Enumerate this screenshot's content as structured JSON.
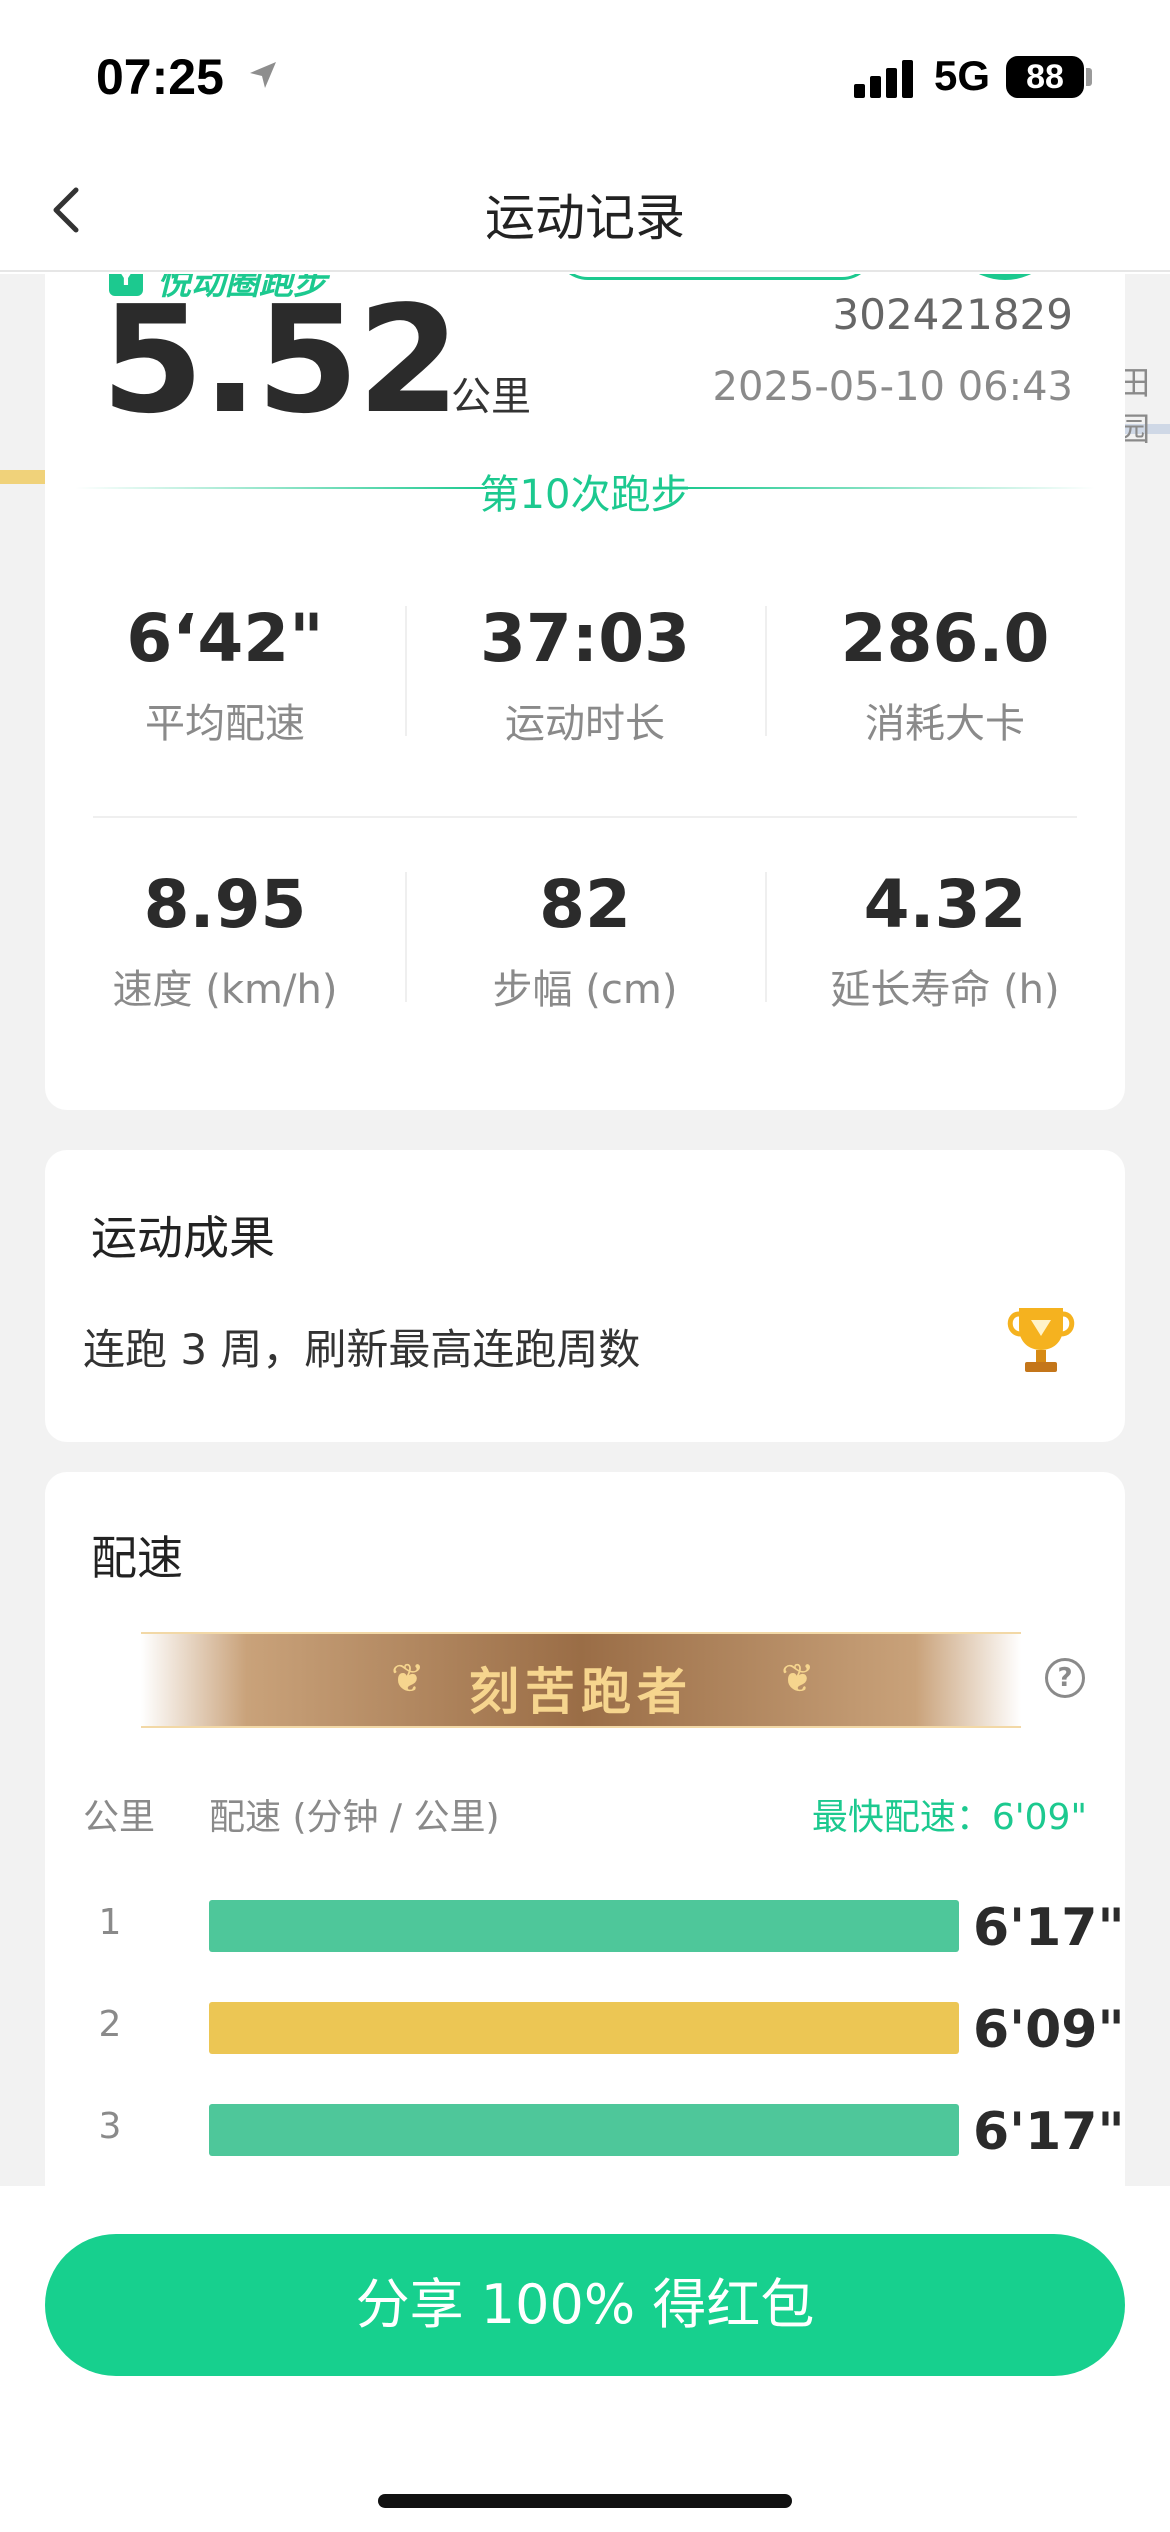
{
  "status_bar": {
    "time": "07:25",
    "network": "5G",
    "battery": "88"
  },
  "nav": {
    "title": "运动记录"
  },
  "map": {
    "label": "田园"
  },
  "summary": {
    "brand": "悦动圈跑步",
    "distance": "5.52",
    "distance_unit": "公里",
    "record_id": "302421829",
    "date": "2025-05-10 06:43",
    "run_count": "第10次跑步",
    "stats": [
      {
        "value": "6‘42\"",
        "label": "平均配速"
      },
      {
        "value": "37:03",
        "label": "运动时长"
      },
      {
        "value": "286.0",
        "label": "消耗大卡"
      },
      {
        "value": "8.95",
        "label": "速度 (km/h)"
      },
      {
        "value": "82",
        "label": "步幅 (cm)"
      },
      {
        "value": "4.32",
        "label": "延长寿命 (h)"
      }
    ]
  },
  "achievement": {
    "title": "运动成果",
    "text": "连跑 3 周，刷新最高连跑周数"
  },
  "pace": {
    "title": "配速",
    "banner": "刻苦跑者",
    "col_km": "公里",
    "col_pace": "配速 (分钟 / 公里)",
    "fastest": "最快配速：6'09\"",
    "rows": [
      {
        "km": "1",
        "pace": "6'17\"",
        "fraction": 1.0,
        "color": "#4ec79a"
      },
      {
        "km": "2",
        "pace": "6'09\"",
        "fraction": 1.0,
        "color": "#ecc654"
      },
      {
        "km": "3",
        "pace": "6'17\"",
        "fraction": 1.0,
        "color": "#4ec79a"
      }
    ]
  },
  "share_button": "分享 100% 得红包",
  "colors": {
    "accent": "#17d08e",
    "fastest_bar": "#ecc654",
    "normal_bar": "#4ec79a"
  }
}
